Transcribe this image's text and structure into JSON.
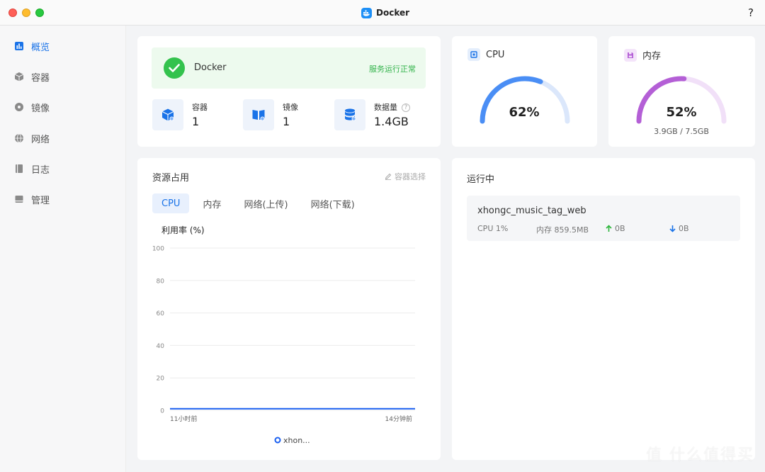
{
  "window": {
    "title": "Docker",
    "help": "?"
  },
  "sidebar": {
    "items": [
      {
        "label": "概览",
        "icon": "chart-bar-icon",
        "active": true
      },
      {
        "label": "容器",
        "icon": "cube-icon"
      },
      {
        "label": "镜像",
        "icon": "disc-icon"
      },
      {
        "label": "网络",
        "icon": "globe-icon"
      },
      {
        "label": "日志",
        "icon": "book-icon"
      },
      {
        "label": "管理",
        "icon": "box-icon"
      }
    ]
  },
  "status": {
    "name": "Docker",
    "text": "服务运行正常",
    "color": "#33c24d"
  },
  "stats": [
    {
      "label": "容器",
      "value": "1",
      "icon": "container-icon"
    },
    {
      "label": "镜像",
      "value": "1",
      "icon": "image-book-icon"
    },
    {
      "label": "数据量",
      "value": "1.4GB",
      "icon": "database-icon",
      "help": "?"
    }
  ],
  "cpu_gauge": {
    "title": "CPU",
    "value_text": "62%",
    "percent": 62,
    "color": "#4a8ef5"
  },
  "mem_gauge": {
    "title": "内存",
    "value_text": "52%",
    "percent": 52,
    "sub": "3.9GB / 7.5GB",
    "color": "#b45fd6"
  },
  "resources": {
    "title": "资源占用",
    "select_label": "容器选择",
    "tabs": [
      "CPU",
      "内存",
      "网络(上传)",
      "网络(下载)"
    ],
    "active_tab": 0,
    "chart_label": "利用率 (%)"
  },
  "chart_data": {
    "type": "line",
    "ylim": [
      0,
      100
    ],
    "y_ticks": [
      "100",
      "80",
      "60",
      "40",
      "20",
      "0"
    ],
    "x_tick_labels": [
      "11小时前",
      "14分钟前"
    ],
    "series": [
      {
        "name": "xhon...",
        "values": [
          1,
          1
        ],
        "color": "#1a5ff0"
      }
    ],
    "legend": "bottom-center",
    "grid": true
  },
  "running": {
    "title": "运行中",
    "items": [
      {
        "name": "xhongc_music_tag_web",
        "cpu": "CPU 1%",
        "mem": "内存 859.5MB",
        "up": "0B",
        "down": "0B"
      }
    ]
  },
  "watermark": "值 什么值得买"
}
